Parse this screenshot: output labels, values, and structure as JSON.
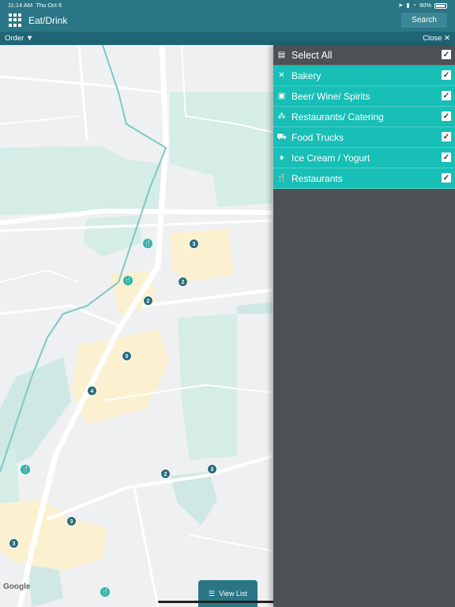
{
  "status": {
    "time": "11:14 AM",
    "date": "Thu Oct 6",
    "battery": "90%"
  },
  "header": {
    "title": "Eat/Drink",
    "search_label": "Search"
  },
  "subbar": {
    "order_label": "Order ▼",
    "close_label": "Close ✕"
  },
  "map": {
    "attribution": "Google",
    "view_list_label": "View List",
    "clusters": [
      "3",
      "2",
      "2",
      "5",
      "4",
      "3",
      "2",
      "3",
      "3"
    ]
  },
  "filters": {
    "select_all_label": "Select All",
    "categories": [
      {
        "label": "Bakery",
        "icon": "bakery-icon",
        "checked": true
      },
      {
        "label": "Beer/ Wine/ Spirits",
        "icon": "beer-icon",
        "checked": true
      },
      {
        "label": "Restaurants/ Catering",
        "icon": "catering-icon",
        "checked": true
      },
      {
        "label": "Food Trucks",
        "icon": "truck-icon",
        "checked": true
      },
      {
        "label": "Ice Cream / Yogurt",
        "icon": "ice-cream-icon",
        "checked": true
      },
      {
        "label": "Restaurants",
        "icon": "fork-knife-icon",
        "checked": true
      }
    ]
  },
  "colors": {
    "header": "#2a7686",
    "panel": "#4c5254",
    "accent": "#17bfb6"
  }
}
